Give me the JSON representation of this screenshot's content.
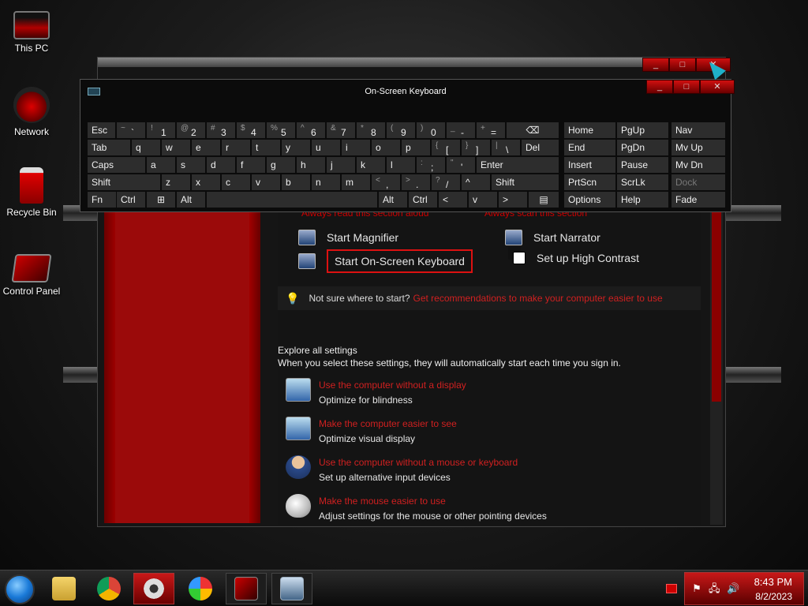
{
  "desktop": {
    "icons": [
      {
        "label": "This PC",
        "icon": "computer-icon"
      },
      {
        "label": "Network",
        "icon": "network-icon"
      },
      {
        "label": "Recycle Bin",
        "icon": "recycle-bin-icon"
      },
      {
        "label": "Control Panel",
        "icon": "control-panel-icon"
      }
    ]
  },
  "ease_window": {
    "truncated_links": [
      "Always read this section aloud",
      "Always scan this section"
    ],
    "tools": [
      {
        "label": "Start Magnifier",
        "icon": "magnifier-icon"
      },
      {
        "label": "Start Narrator",
        "icon": "narrator-icon"
      },
      {
        "label": "Start On-Screen Keyboard",
        "icon": "keyboard-icon"
      },
      {
        "label": "Set up High Contrast",
        "icon": "high-contrast-icon"
      }
    ],
    "hint_text": "Not sure where to start?",
    "hint_link": "Get recommendations to make your computer easier to use",
    "explore_heading": "Explore all settings",
    "explore_sub": "When you select these settings, they will automatically start each time you sign in.",
    "settings": [
      {
        "link": "Use the computer without a display",
        "desc": "Optimize for blindness",
        "icon": "display-icon"
      },
      {
        "link": "Make the computer easier to see",
        "desc": "Optimize visual display",
        "icon": "monitor-icon"
      },
      {
        "link": "Use the computer without a mouse or keyboard",
        "desc": "Set up alternative input devices",
        "icon": "person-icon"
      },
      {
        "link": "Make the mouse easier to use",
        "desc": "Adjust settings for the mouse or other pointing devices",
        "icon": "mouse-icon"
      }
    ],
    "accent_color": "#d02020"
  },
  "osk": {
    "title": "On-Screen Keyboard",
    "rows": [
      [
        "Esc",
        "~ `",
        "! 1",
        "@ 2",
        "# 3",
        "$ 4",
        "% 5",
        "^ 6",
        "& 7",
        "* 8",
        "( 9",
        ") 0",
        "_ -",
        "+ =",
        "backspace-icon"
      ],
      [
        "Tab",
        "q",
        "w",
        "e",
        "r",
        "t",
        "y",
        "u",
        "i",
        "o",
        "p",
        "{ [",
        "} ]",
        "| \\",
        "Del"
      ],
      [
        "Caps",
        "a",
        "s",
        "d",
        "f",
        "g",
        "h",
        "j",
        "k",
        "l",
        ": ;",
        "\" '",
        "Enter"
      ],
      [
        "Shift",
        "z",
        "x",
        "c",
        "v",
        "b",
        "n",
        "m",
        "< ,",
        "> .",
        "? /",
        "^",
        "Shift"
      ],
      [
        "Fn",
        "Ctrl",
        "windows-icon",
        "Alt",
        "",
        "Alt",
        "Ctrl",
        "<",
        "v",
        ">",
        "menu-icon"
      ]
    ],
    "nav_keys": [
      [
        "Home",
        "PgUp",
        "Nav"
      ],
      [
        "End",
        "PgDn",
        "Mv Up"
      ],
      [
        "Insert",
        "Pause",
        "Mv Dn"
      ],
      [
        "PrtScn",
        "ScrLk",
        "Dock"
      ],
      [
        "Options",
        "Help",
        "Fade"
      ]
    ]
  },
  "taskbar": {
    "apps": [
      "file-explorer-icon",
      "chrome-icon",
      "settings-icon",
      "browser-lock-icon",
      "control-panel-icon",
      "on-screen-keyboard-icon"
    ],
    "time": "8:43 PM",
    "date": "8/2/2023",
    "tray_color": "#c81818"
  }
}
